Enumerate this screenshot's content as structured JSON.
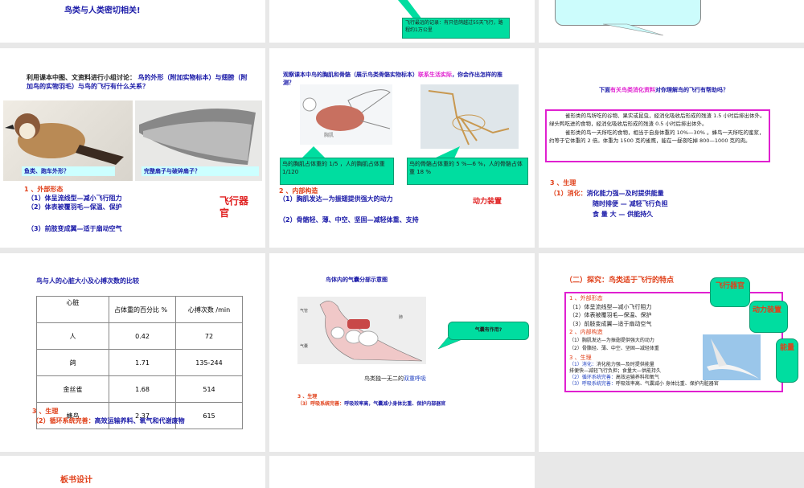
{
  "slides": {
    "s1": {
      "text": "鸟类与人类密切相关!"
    },
    "s2": {
      "callout": "飞行最远的记录：有只信鸽越过55天飞行，路程约1万公里"
    },
    "s4": {
      "intro": "利用课本中图、文资料进行小组讨论：",
      "question": "鸟的外形（附加实物标本）与翅膀（附加鸟的实物羽毛）与鸟的飞行有什么关系？",
      "label1": "鱼类、跑车外形？",
      "label2": "完整扇子与破碎扇子？",
      "heading": "1 、外部形态",
      "items": [
        "（1）体呈流线型—减小飞行阻力",
        "（2）体表被覆羽毛—保温、保护",
        "（3）前肢变成翼—适于扇动空气"
      ],
      "tag": "飞行器官"
    },
    "s5": {
      "q1": "观察课本中鸟的胸肌和骨骼（展示鸟类骨骼实物标本）",
      "q2": "联系生活实际",
      "q3": "，你会作出怎样的推测？",
      "img_label": "胸肌",
      "callout1": "鸟的胸肌占体重的 1/5 ，人的胸肌占体重 1/120",
      "callout2": "鸟的骨骼占体重的 5 %—6 %，人的骨骼占体重 18 %",
      "heading": "2 、内部构造",
      "items": [
        "（1）胸肌发达—为振翅提供强大的动力",
        "（2）骨骼轻、薄、中空、坚固—减轻体重、支持"
      ],
      "tag": "动力装置"
    },
    "s6": {
      "t1": "下面",
      "t2": "有关鸟类消化资料",
      "t3": "对你理解鸟的飞行有帮助吗？",
      "p1": "雀形类的鸟所吃的谷物、果实或昆虫，经消化吸收后形成的残渣 1.5 小时后排出体外。绿头鸭吃进的食物，经消化吸收后形成的残渣 0.5 小时后排出体外。",
      "p2": "雀形类的鸟一天所吃的食物，相当于自身体重的 10%—30% 。蜂鸟一天所吃的蜜浆，约等于它体重的 2 倍。体重为 1500 克的雀鹰，能在一昼夜吃掉 800—1000 克的肉。",
      "heading": "3 、生理",
      "l1a": "（1）消化：",
      "l1b": "消化能力强—及时提供能量",
      "l2": "随时排便 — 减轻飞行负担",
      "l3": "食 量 大 — 供能持久"
    },
    "s7": {
      "title": "鸟与人的心脏大小及心搏次数的比较",
      "headers": [
        "心脏",
        "占体重的百分比 %",
        "心搏次数 /min"
      ],
      "rows": [
        [
          "人",
          "0.42",
          "72"
        ],
        [
          "鸽",
          "1.71",
          "135-244"
        ],
        [
          "金丝雀",
          "1.68",
          "514"
        ],
        [
          "蜂鸟",
          "2.37",
          "615"
        ]
      ],
      "heading": "3 、生理",
      "l1a": "（2）循环系统完善：",
      "l1b": "高效运输养料、氧气和代谢废物"
    },
    "s8": {
      "title": "鸟体内的气囊分部示意图",
      "lbl_trachea": "气管",
      "lbl_lung": "肺",
      "lbl_sac": "气囊",
      "callout": "气囊有作用?",
      "caption_a": "鸟类独一无二的",
      "caption_b": "双重呼吸",
      "heading": "3 、生理",
      "l1a": "（3）呼吸系统完善：",
      "l1b": "呼吸效率高，气囊减小身体比重、保护内部器官"
    },
    "s9": {
      "title": "（二）探究：鸟类适于飞行的特点",
      "h1": "1 、外部形态",
      "a": [
        "（1）体呈流线型—减小飞行阻力",
        "（2）体表被覆羽毛—保温、保护",
        "（3）前肢变成翼—适于扇动空气"
      ],
      "h2": "2 、内部构造",
      "b": [
        "（1）胸肌发达—为振翅提供强大的动力",
        "（2）骨骼轻、薄、中空、坚固—减轻体重"
      ],
      "h3": "3 、生理",
      "c1a": "（1）消化：",
      "c1b": "消化能力强—及时提供能量",
      "c2": "排便快—减轻飞行负担；食量大—供能持久",
      "c3a": "（2）循环系统完善：",
      "c3b": "高效运输养料和氧气",
      "c4a": "（3）呼吸系统完善：",
      "c4b": "呼吸效率高、气囊减小 身体比重、保护内脏器官",
      "tag1": "飞行器官",
      "tag2": "动力装置",
      "tag3": "能量"
    },
    "s10": {
      "title": "板书设计"
    }
  },
  "colors": {
    "blue": "#1a1aa8",
    "red": "#e0401a",
    "magenta": "#e020d0",
    "green": "#00dda0",
    "background": "#e8e8e8"
  }
}
